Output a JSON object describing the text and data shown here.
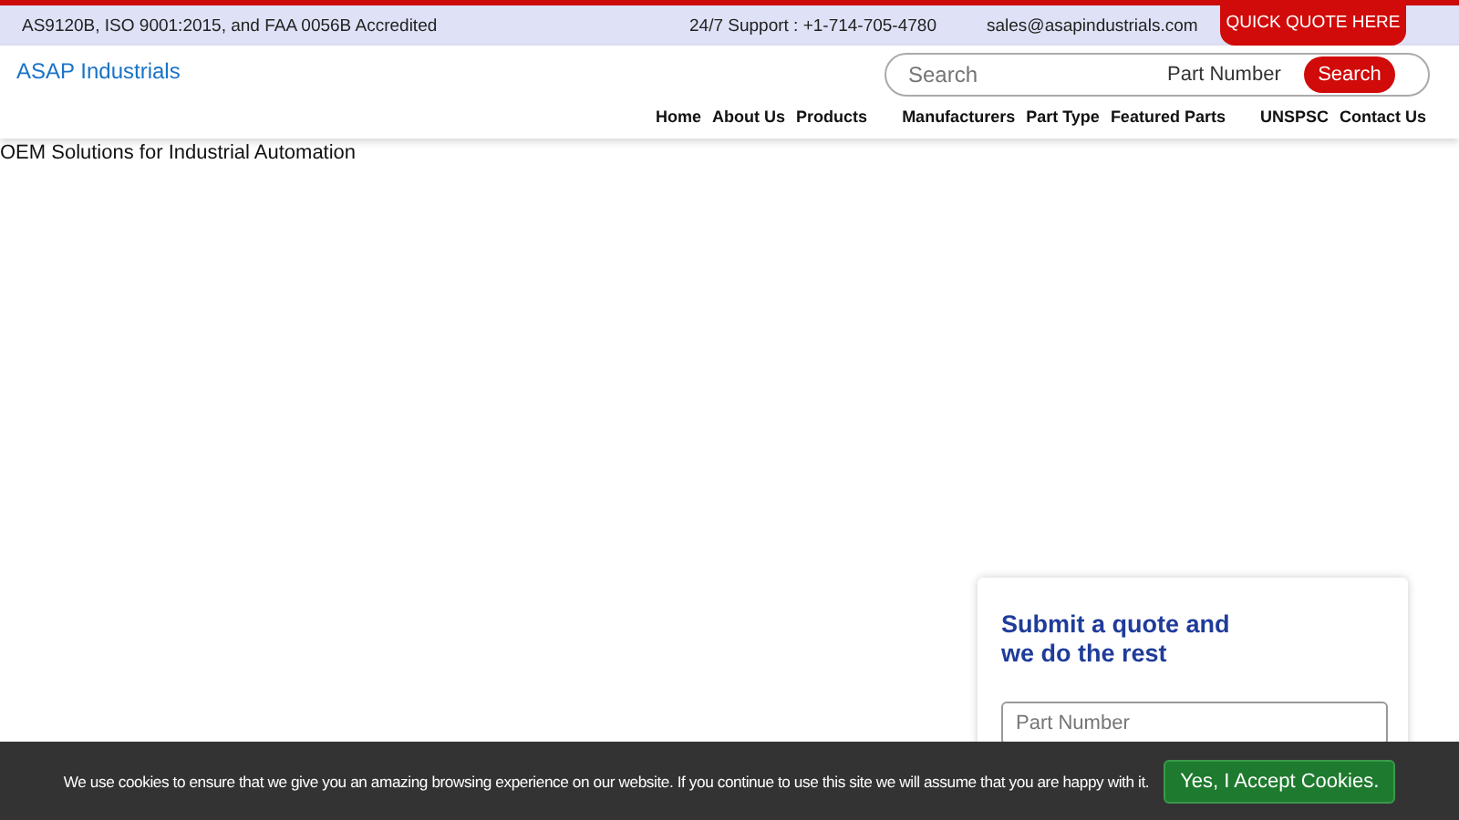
{
  "top_bar": {
    "accreditation": "AS9120B, ISO 9001:2015, and FAA 0056B Accredited",
    "support": "24/7 Support : +1-714-705-4780",
    "email": "sales@asapindustrials.com",
    "quote_button": "QUICK QUOTE HERE"
  },
  "header": {
    "logo": "ASAP Industrials",
    "search": {
      "placeholder": "Search",
      "type_label": "Part Number",
      "button": "Search"
    }
  },
  "nav": [
    "Home",
    "About Us",
    "Products",
    "Manufacturers",
    "Part Type",
    "Featured Parts",
    "UNSPSC",
    "Contact Us"
  ],
  "hero": {
    "caption": "OEM Solutions for Industrial Automation"
  },
  "quote_form": {
    "title": "Submit a quote and we do the rest",
    "fields": [
      {
        "placeholder": "Part Number"
      }
    ]
  },
  "cookie_bar": {
    "text": "We use cookies to ensure that we give you an amazing browsing experience on our website. If you continue to use this site we will assume that you are happy with it.",
    "button": "Yes, I Accept Cookies."
  }
}
